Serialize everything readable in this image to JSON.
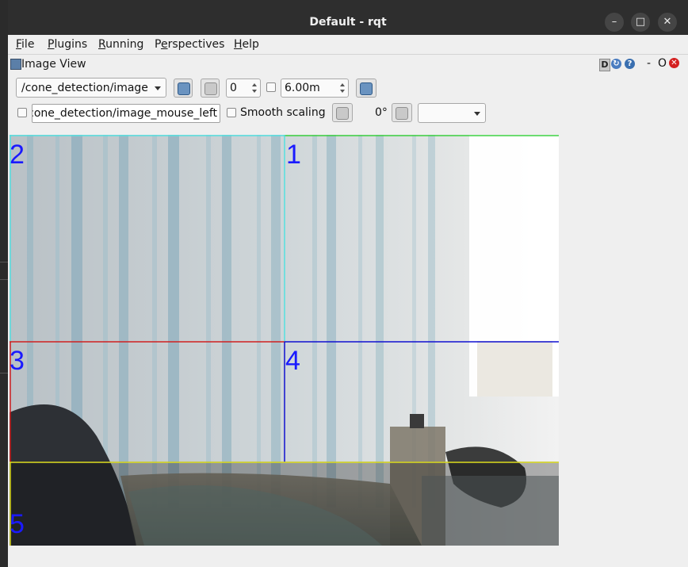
{
  "window": {
    "title": "Default - rqt",
    "minimize_label": "–",
    "maximize_label": "□",
    "close_label": "✕"
  },
  "menubar": {
    "items": [
      {
        "label": "File",
        "mnemonic": "F",
        "rest": "ile"
      },
      {
        "label": "Plugins",
        "mnemonic": "P",
        "rest": "lugins"
      },
      {
        "label": "Running",
        "mnemonic": "R",
        "rest": "unning"
      },
      {
        "label": "Perspectives",
        "pre": "P",
        "mnemonic": "e",
        "rest": "rspectives"
      },
      {
        "label": "Help",
        "mnemonic": "H",
        "rest": "elp"
      }
    ]
  },
  "plugin": {
    "title": "Image View",
    "header_d": "D",
    "header_dash": "-",
    "header_o": "O"
  },
  "toolbar1": {
    "topic": "/cone_detection/image",
    "spin_value": "0",
    "max_range": "6.00m"
  },
  "toolbar2": {
    "mouse_topic": "cone_detection/image_mouse_left",
    "smooth_scaling_label": "Smooth scaling",
    "rotation": "0°",
    "color_scheme": ""
  },
  "image": {
    "grid_labels": [
      "2",
      "1",
      "3",
      "4",
      "5"
    ],
    "line_colors": {
      "cyan": "#55e0e0",
      "green": "#3cd040",
      "red": "#d02020",
      "blue": "#1010d0",
      "yellow": "#e0e020"
    },
    "label_color": "#1a1aff"
  }
}
